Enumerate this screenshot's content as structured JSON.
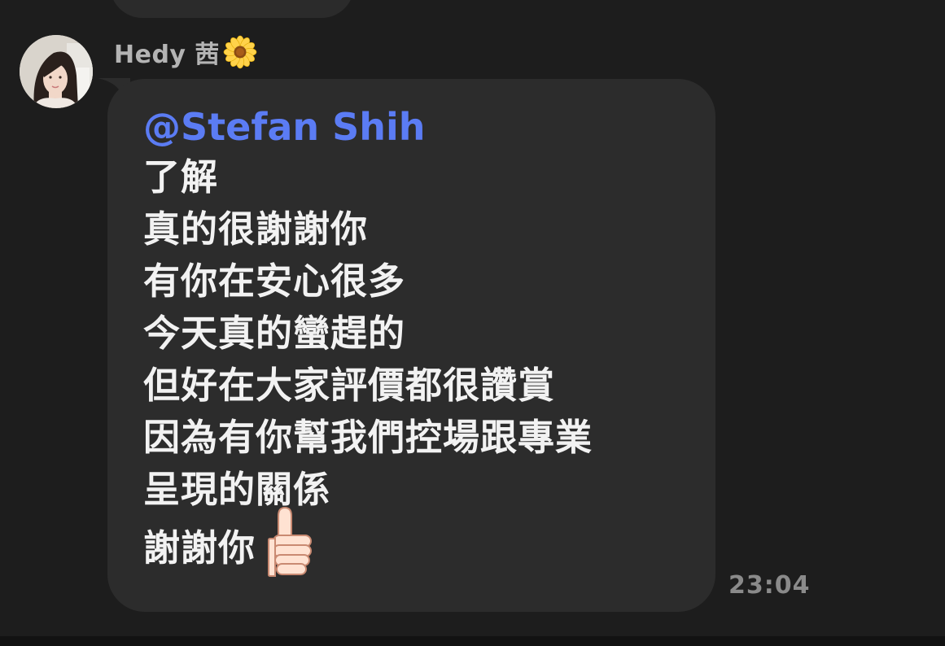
{
  "sender": {
    "name": "Hedy 茜",
    "avatar_icon": "profile-photo",
    "name_emoji_icon": "sunflower-icon"
  },
  "message": {
    "mention": "@Stefan Shih",
    "lines": [
      "了解",
      "真的很謝謝你",
      "有你在安心很多",
      "今天真的蠻趕的",
      "但好在大家評價都很讚賞",
      "因為有你幫我們控場跟專業",
      "呈現的關係"
    ],
    "last_line": "謝謝你",
    "last_emoji_icon": "thumbs-up-icon",
    "timestamp": "23:04"
  },
  "colors": {
    "background": "#1d1d1d",
    "bubble": "#2c2c2c",
    "mention": "#5b7cf4",
    "text": "#f2f2f2",
    "meta_text": "#8a8a8a"
  }
}
